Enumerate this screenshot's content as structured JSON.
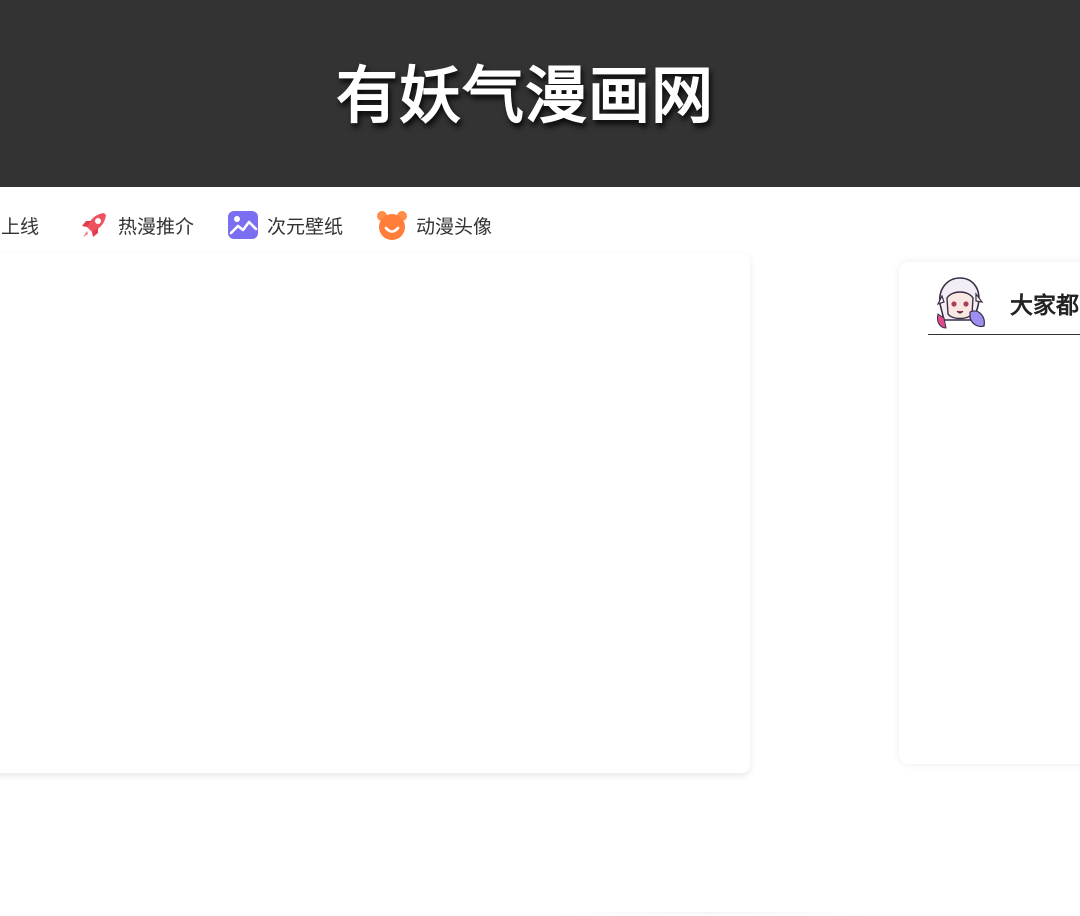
{
  "header": {
    "site_title": "有妖气漫画网"
  },
  "nav": {
    "items": [
      {
        "label": "漫上线",
        "icon": "partial-icon"
      },
      {
        "label": "热漫推介",
        "icon": "rocket-icon",
        "color": "#f0525f"
      },
      {
        "label": "次元壁纸",
        "icon": "picture-icon",
        "color": "#7b6ef0"
      },
      {
        "label": "动漫头像",
        "icon": "bear-face-icon",
        "color": "#ff7f3a"
      }
    ]
  },
  "sidebar": {
    "title": "大家都",
    "avatar": "anime-avatar-icon"
  },
  "colors": {
    "header_bg": "#333333",
    "title_text": "#ffffff",
    "nav_text": "#333333"
  }
}
